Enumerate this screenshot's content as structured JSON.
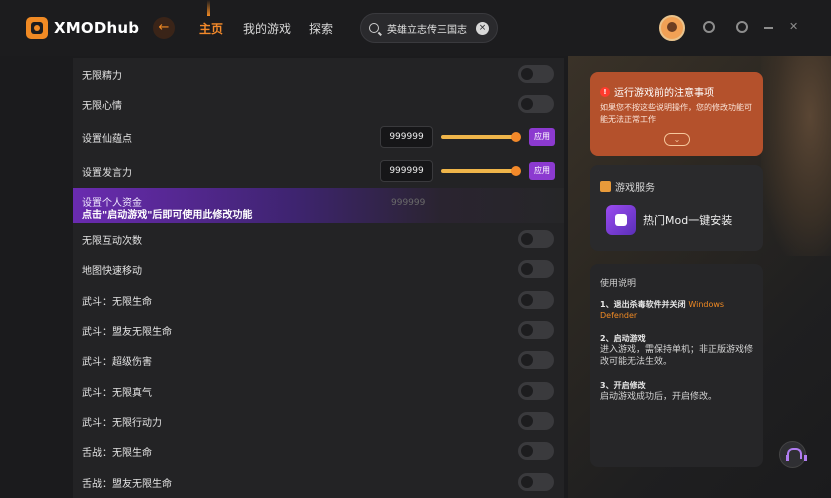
{
  "app": {
    "logo_text": "XMODhub"
  },
  "nav": {
    "back_icon": "back-arrow-icon",
    "items": [
      {
        "label": "主页",
        "active": true
      },
      {
        "label": "我的游戏",
        "active": false
      },
      {
        "label": "探索",
        "active": false
      }
    ]
  },
  "search": {
    "value": "英雄立志传三国志"
  },
  "colors": {
    "accent": "#f3892a",
    "purple": "#8c3ad0",
    "notice_bg": "#b4512c"
  },
  "list": {
    "rows": [
      {
        "label": "无限精力",
        "type": "toggle",
        "on": false
      },
      {
        "label": "无限心情",
        "type": "toggle",
        "on": false
      },
      {
        "label": "设置仙蕴点",
        "type": "input",
        "value": "999999",
        "apply": "应用"
      },
      {
        "label": "设置发言力",
        "type": "input",
        "value": "999999",
        "apply": "应用"
      }
    ],
    "banner": {
      "label": "设置个人资金",
      "note": "点击\"启动游戏\"后即可使用此修改功能",
      "value": "999999"
    },
    "rows2": [
      {
        "label": "无限互动次数"
      },
      {
        "label": "地图快速移动"
      },
      {
        "label": "武斗：无限生命"
      },
      {
        "label": "武斗：盟友无限生命"
      },
      {
        "label": "武斗：超级伤害"
      },
      {
        "label": "武斗：无限真气"
      },
      {
        "label": "武斗：无限行动力"
      },
      {
        "label": "舌战：无限生命"
      },
      {
        "label": "舌战：盟友无限生命"
      }
    ]
  },
  "notice": {
    "title": "运行游戏前的注意事项",
    "body": "如果您不按这些说明操作，您的修改功能可能无法正常工作"
  },
  "service": {
    "title": "游戏服务",
    "mod_label": "热门Mod一键安装"
  },
  "guide": {
    "title": "使用说明",
    "step1_title": "1、退出杀毒软件并关闭",
    "step1_highlight": "Windows Defender",
    "step2_title": "2、启动游戏",
    "step2_body": "进入游戏，需保持单机；非正版游戏修改可能无法生效。",
    "step3_title": "3、开启修改",
    "step3_body": "启动游戏成功后，开启修改。"
  }
}
